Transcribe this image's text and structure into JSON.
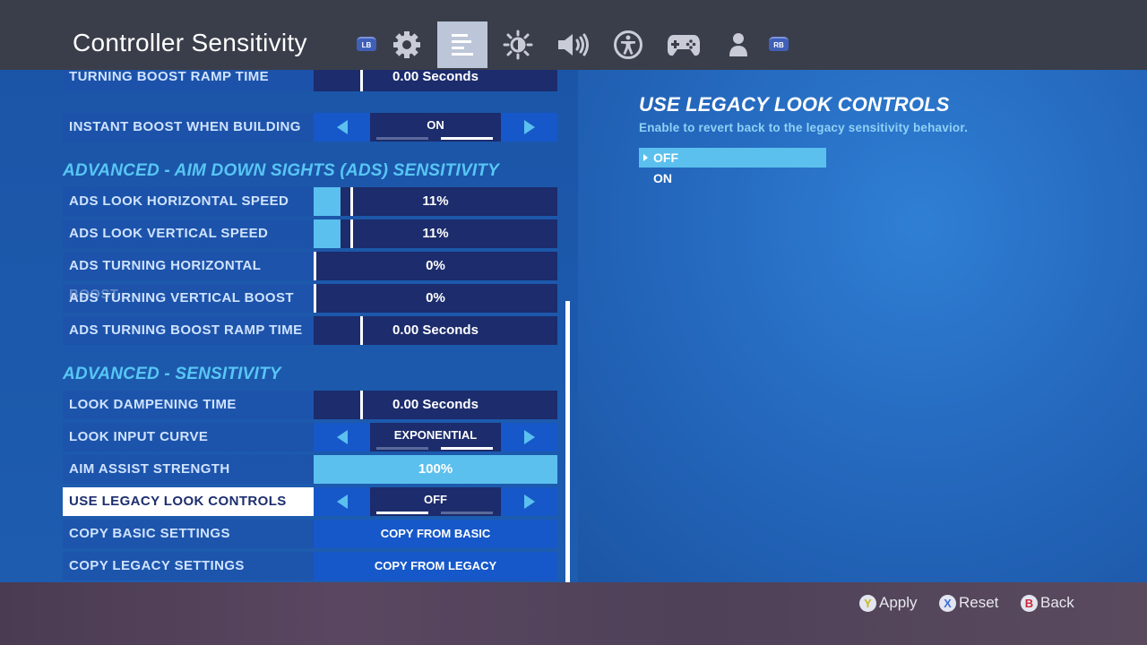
{
  "header": {
    "title": "Controller Sensitivity",
    "tabs": [
      {
        "name": "tab-lb",
        "label": "LB"
      },
      {
        "name": "tab-game-settings",
        "icon": "gear-icon"
      },
      {
        "name": "tab-controller-sensitivity",
        "icon": "sliders-icon",
        "active": true
      },
      {
        "name": "tab-brightness",
        "icon": "brightness-icon"
      },
      {
        "name": "tab-audio",
        "icon": "speaker-icon"
      },
      {
        "name": "tab-accessibility",
        "icon": "accessibility-icon"
      },
      {
        "name": "tab-controller",
        "icon": "gamepad-icon"
      },
      {
        "name": "tab-account",
        "icon": "person-icon"
      },
      {
        "name": "tab-rb",
        "label": "RB"
      }
    ],
    "lb_label": "LB",
    "rb_label": "RB"
  },
  "settings": {
    "turning_boost_ramp_time": {
      "label": "TURNING BOOST RAMP TIME",
      "value": "0.00 Seconds"
    },
    "instant_boost_when_building": {
      "label": "INSTANT BOOST WHEN BUILDING",
      "value": "ON"
    },
    "section_ads": "ADVANCED - AIM DOWN SIGHTS (ADS) SENSITIVITY",
    "ads_look_horizontal_speed": {
      "label": "ADS LOOK HORIZONTAL SPEED",
      "value": "11%",
      "fraction": 0.11
    },
    "ads_look_vertical_speed": {
      "label": "ADS LOOK VERTICAL SPEED",
      "value": "11%",
      "fraction": 0.11
    },
    "ads_turning_horizontal_boost": {
      "label": "ADS TURNING HORIZONTAL BOOST",
      "value": "0%",
      "fraction": 0
    },
    "ads_turning_vertical_boost": {
      "label": "ADS TURNING VERTICAL BOOST",
      "value": "0%",
      "fraction": 0
    },
    "ads_turning_boost_ramp_time": {
      "label": "ADS TURNING BOOST RAMP TIME",
      "value": "0.00 Seconds"
    },
    "section_sensitivity": "ADVANCED - SENSITIVITY",
    "look_dampening_time": {
      "label": "LOOK DAMPENING TIME",
      "value": "0.00 Seconds"
    },
    "look_input_curve": {
      "label": "LOOK INPUT CURVE",
      "value": "EXPONENTIAL"
    },
    "aim_assist_strength": {
      "label": "AIM ASSIST STRENGTH",
      "value": "100%",
      "fraction": 1.0
    },
    "use_legacy_look_controls": {
      "label": "USE LEGACY LOOK CONTROLS",
      "value": "OFF"
    },
    "copy_basic_settings": {
      "label": "COPY BASIC SETTINGS",
      "button": "COPY FROM BASIC"
    },
    "copy_legacy_settings": {
      "label": "COPY LEGACY SETTINGS",
      "button": "COPY FROM LEGACY"
    }
  },
  "detail": {
    "title": "USE LEGACY LOOK CONTROLS",
    "description": "Enable to revert back to the legacy sensitivity behavior.",
    "options": [
      "OFF",
      "ON"
    ],
    "selected": "OFF"
  },
  "footer": {
    "apply": {
      "glyph": "Y",
      "label": "Apply",
      "color": "#c9b81e"
    },
    "reset": {
      "glyph": "X",
      "label": "Reset",
      "color": "#3d6fd8"
    },
    "back": {
      "glyph": "B",
      "label": "Back",
      "color": "#c9283a"
    }
  },
  "colors": {
    "accent_cyan": "#5bc0ee",
    "section_header": "#58c6f4",
    "control_dark": "#1c2c6c",
    "button_blue": "#1658c9",
    "topbar": "#3a3e4a"
  }
}
